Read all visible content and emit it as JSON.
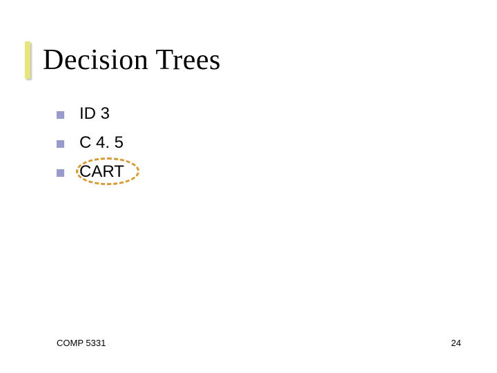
{
  "title": "Decision Trees",
  "bullets": {
    "b1": "ID 3",
    "b2": "C 4. 5",
    "b3": "CART"
  },
  "footer": {
    "course": "COMP 5331",
    "page": "24"
  },
  "colors": {
    "accent_bar": "#e6e67a",
    "bullet_square": "#9a9acc",
    "highlight_stroke": "#d99a2e"
  }
}
